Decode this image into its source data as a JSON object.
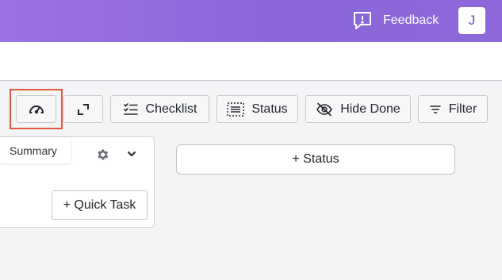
{
  "header": {
    "feedback_label": "Feedback",
    "feedback_icon": "message-alert-icon",
    "avatar_initial": "J"
  },
  "toolbar": {
    "summary_icon": "speedometer-icon",
    "expand_icon": "expand-icon",
    "checklist_label": "Checklist",
    "status_label": "Status",
    "hide_done_label": "Hide Done",
    "filter_label": "Filter"
  },
  "tooltip": {
    "text": "Summary"
  },
  "board": {
    "quick_task_label": "+ Quick Task",
    "add_status_label": "+ Status"
  },
  "colors": {
    "header_gradient_start": "#9a74e0",
    "header_gradient_end": "#8c68da",
    "highlight": "#e2583c",
    "avatar_text": "#6b46c1"
  }
}
